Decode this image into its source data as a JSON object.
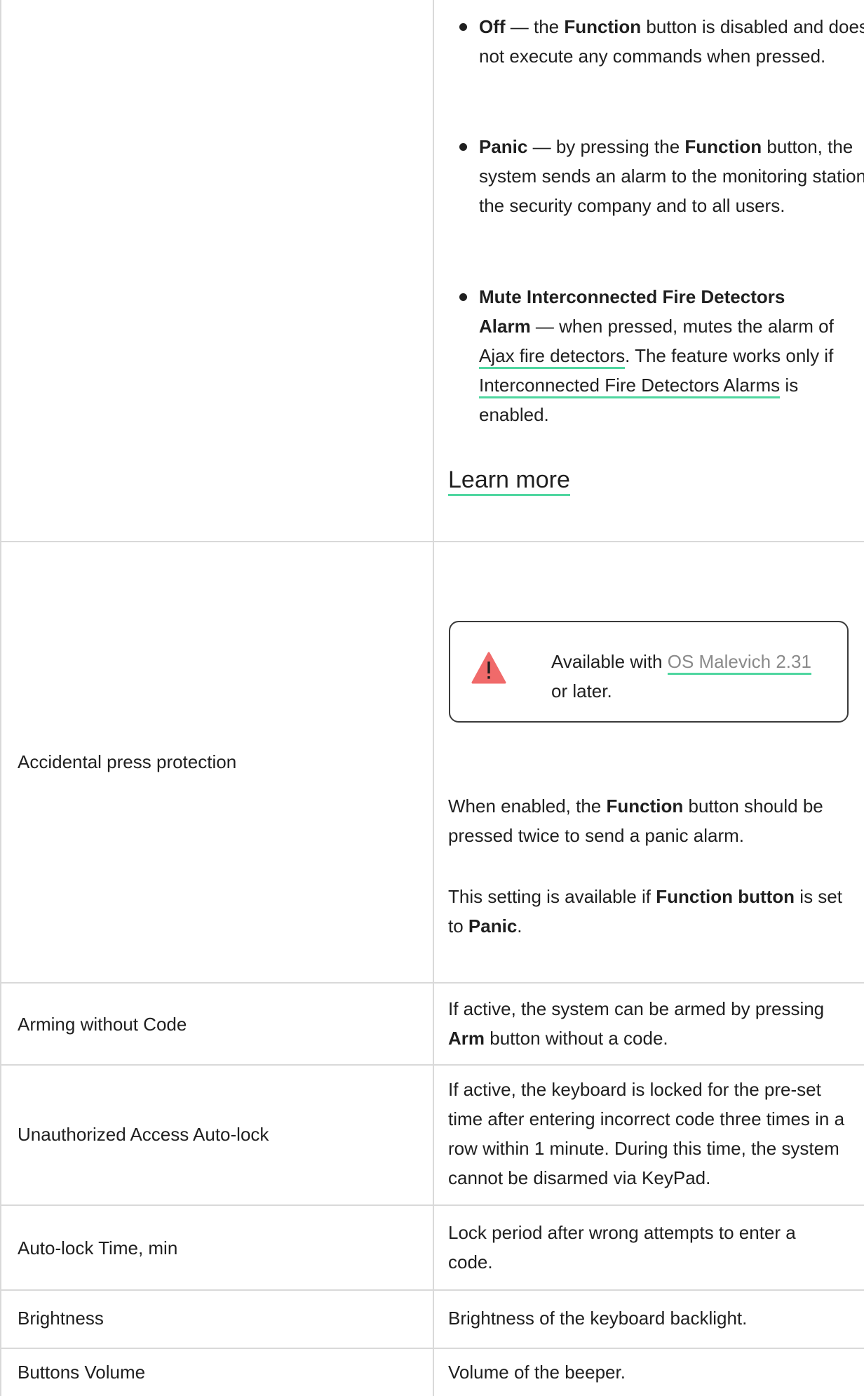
{
  "top_row": {
    "options": [
      {
        "name": "Off",
        "dash": " — the ",
        "keyword": "Function",
        "rest": " button is disabled and does not execute any commands when pressed."
      },
      {
        "name": "Panic",
        "dash": " — by pressing the ",
        "keyword": "Function",
        "rest": " button, the system sends an alarm to the monitoring station of the security company and to all users."
      }
    ],
    "mute_option": {
      "name": "Mute Interconnected Fire Detectors Alarm",
      "text1": " — when pressed, mutes the alarm of ",
      "link1": "Ajax fire detectors",
      "text2": ". The feature works only if ",
      "link2": "Interconnected Fire Detectors Alarms",
      "text3": " is enabled."
    },
    "learn_more": "Learn more"
  },
  "rows": {
    "accidental": {
      "label": "Accidental press protection",
      "notice_text": "Available with ",
      "notice_link": "OS Malevich 2.31",
      "notice_suffix": " or later.",
      "desc1_pre": "When enabled, the ",
      "desc1_bold": "Function",
      "desc1_post": " button should be pressed twice to send a panic alarm.",
      "desc2_pre": "This setting is available if ",
      "desc2_bold": "Function button",
      "desc2_mid": " is set to ",
      "desc2_bold2": "Panic",
      "desc2_post": "."
    },
    "arming": {
      "label": "Arming without Code",
      "desc_pre": "If active, the system can be armed by pressing ",
      "desc_bold": "Arm",
      "desc_post": " button without a code."
    },
    "autolock": {
      "label": "Unauthorized Access Auto-lock",
      "desc": "If active, the keyboard is locked for the pre-set time after entering incorrect code three times in a row within 1 minute. During this time, the system cannot be disarmed via KeyPad."
    },
    "autolock_time": {
      "label": "Auto-lock Time, min",
      "desc": "Lock period after wrong attempts to enter a code."
    },
    "brightness": {
      "label": "Brightness",
      "desc": "Brightness of the keyboard backlight."
    },
    "volume": {
      "label": "Buttons Volume",
      "desc": "Volume of the beeper."
    }
  },
  "colors": {
    "link_underline": "#4fd6a0",
    "warning": "#f06a6a",
    "border": "#d9d9d9"
  },
  "icons": {
    "notice": "warning-triangle-icon"
  }
}
